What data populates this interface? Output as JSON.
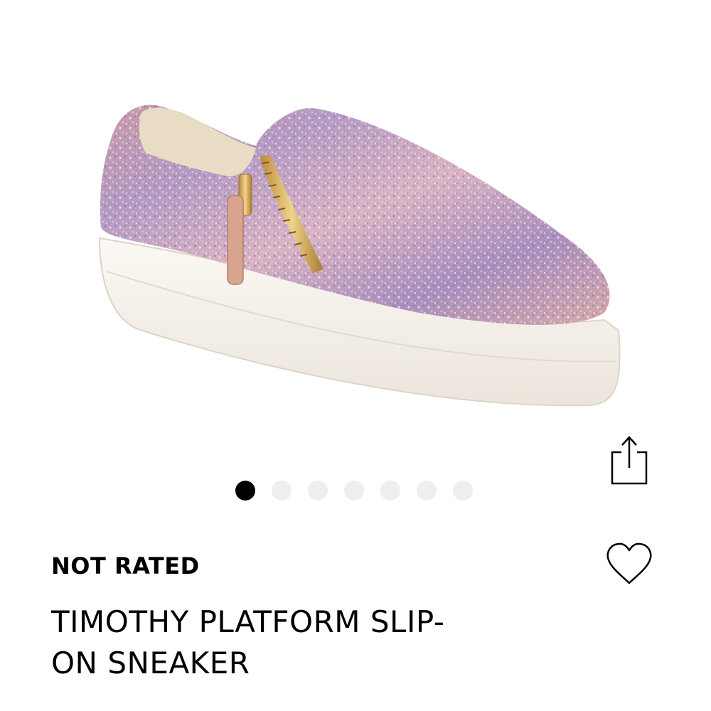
{
  "product": {
    "image_alt": "Glitter platform slip-on sneaker",
    "rating_text": "NOT RATED",
    "title_line1": "TIMOTHY PLATFORM SLIP-",
    "title_line2": "ON SNEAKER"
  },
  "gallery": {
    "total_images": 7,
    "active_index": 0
  },
  "icons": {
    "share": "share-icon",
    "favorite": "heart-icon"
  },
  "colors": {
    "active_dot": "#000000",
    "inactive_dot": "#eeeeee",
    "text": "#000000"
  }
}
